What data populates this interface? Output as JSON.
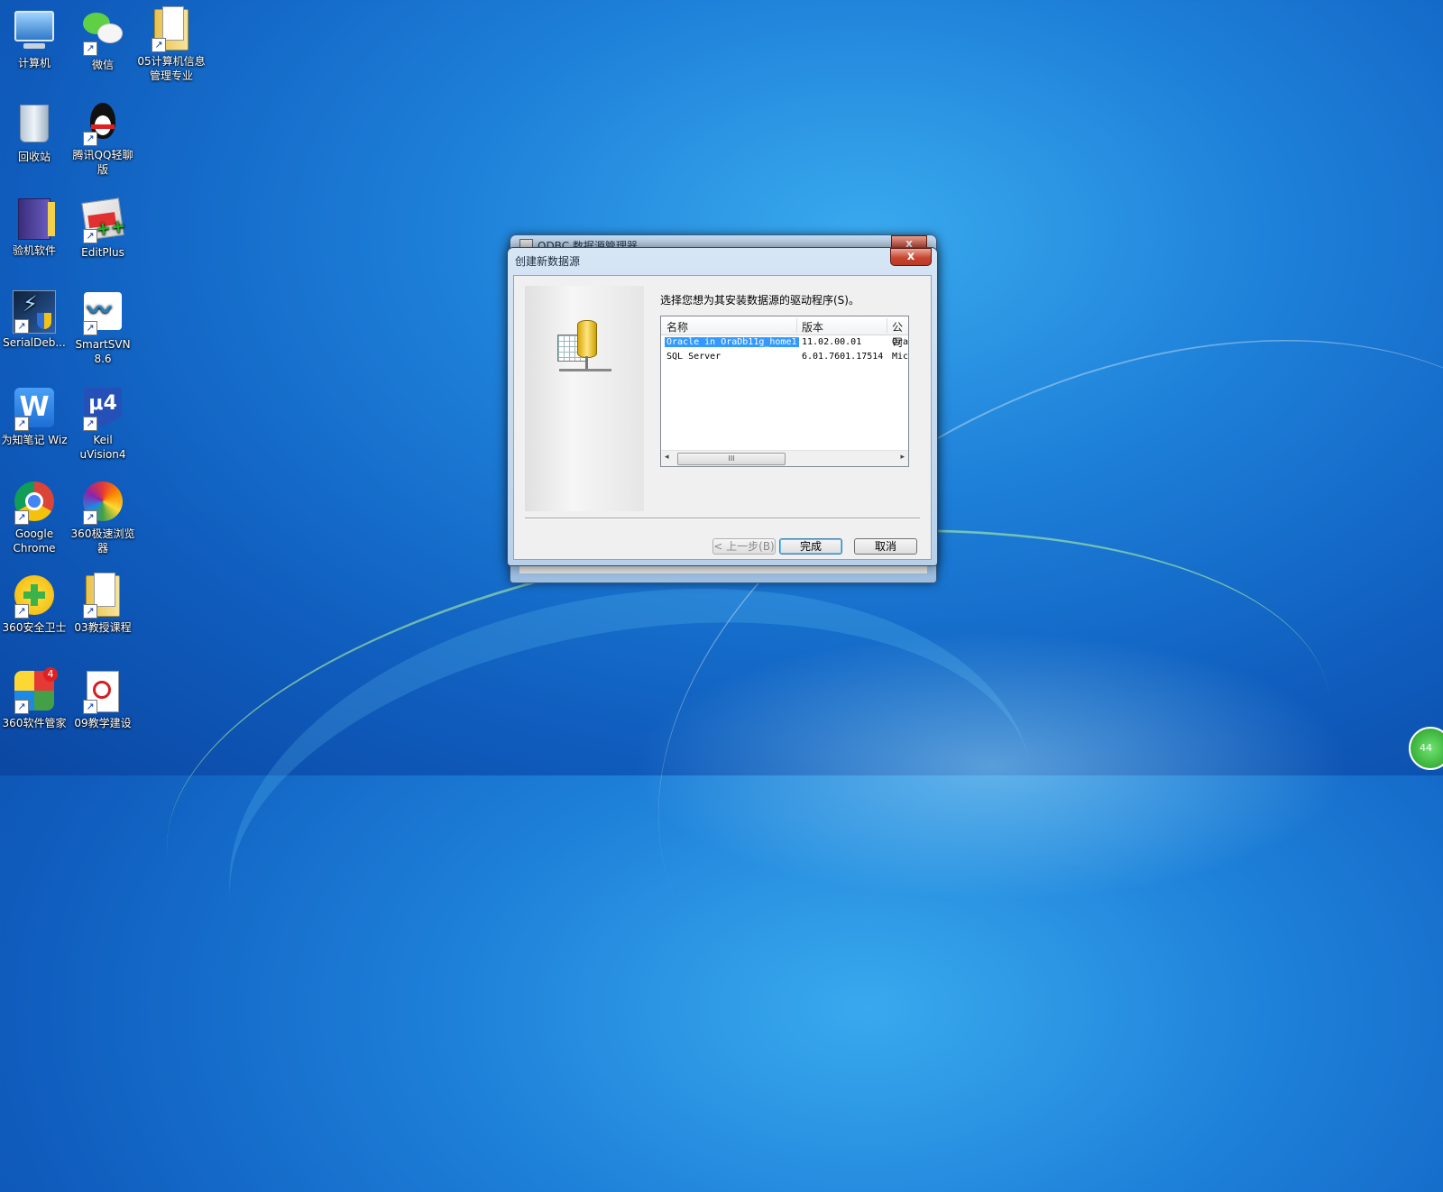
{
  "desktop": {
    "icons": [
      {
        "label": "计算机",
        "icon": "computer-icon"
      },
      {
        "label": "微信",
        "icon": "wechat-icon"
      },
      {
        "label": "05计算机信息管理专业",
        "icon": "folder-icon"
      },
      {
        "label": "回收站",
        "icon": "recycle-bin-icon"
      },
      {
        "label": "腾讯QQ轻聊版",
        "icon": "qq-icon"
      },
      {
        "label": "验机软件",
        "icon": "folder-icon"
      },
      {
        "label": "EditPlus",
        "icon": "editplus-icon"
      },
      {
        "label": "SerialDeb...",
        "icon": "serial-debug-icon"
      },
      {
        "label": "SmartSVN 8.6",
        "icon": "smartsvn-icon"
      },
      {
        "label": "为知笔记 Wiz",
        "icon": "wiz-icon"
      },
      {
        "label": "Keil uVision4",
        "icon": "keil-icon"
      },
      {
        "label": "Google Chrome",
        "icon": "chrome-icon"
      },
      {
        "label": "360极速浏览器",
        "icon": "360-browser-icon"
      },
      {
        "label": "360安全卫士",
        "icon": "360-security-icon"
      },
      {
        "label": "03教授课程",
        "icon": "folder-icon"
      },
      {
        "label": "360软件管家",
        "icon": "360-software-manager-icon"
      },
      {
        "label": "09教学建设",
        "icon": "pdf-icon"
      }
    ],
    "software_manager_badge": "4",
    "tray_badge": "44"
  },
  "background_window": {
    "title": "ODBC 数据源管理器",
    "close_label": "x"
  },
  "dialog": {
    "title": "创建新数据源",
    "close_label": "x",
    "prompt": "选择您想为其安装数据源的驱动程序(S)。",
    "columns": [
      "名称",
      "版本",
      "公司"
    ],
    "drivers": [
      {
        "name": "Oracle in OraDb11g_home1",
        "version": "11.02.00.01",
        "company": "Ora",
        "selected": true
      },
      {
        "name": "SQL Server",
        "version": "6.01.7601.17514",
        "company": "Mic",
        "selected": false
      }
    ],
    "scroll_left": "◂",
    "scroll_right": "▸",
    "scroll_grip": "III",
    "buttons": {
      "back": "< 上一步(B)",
      "finish": "完成",
      "cancel": "取消"
    }
  }
}
